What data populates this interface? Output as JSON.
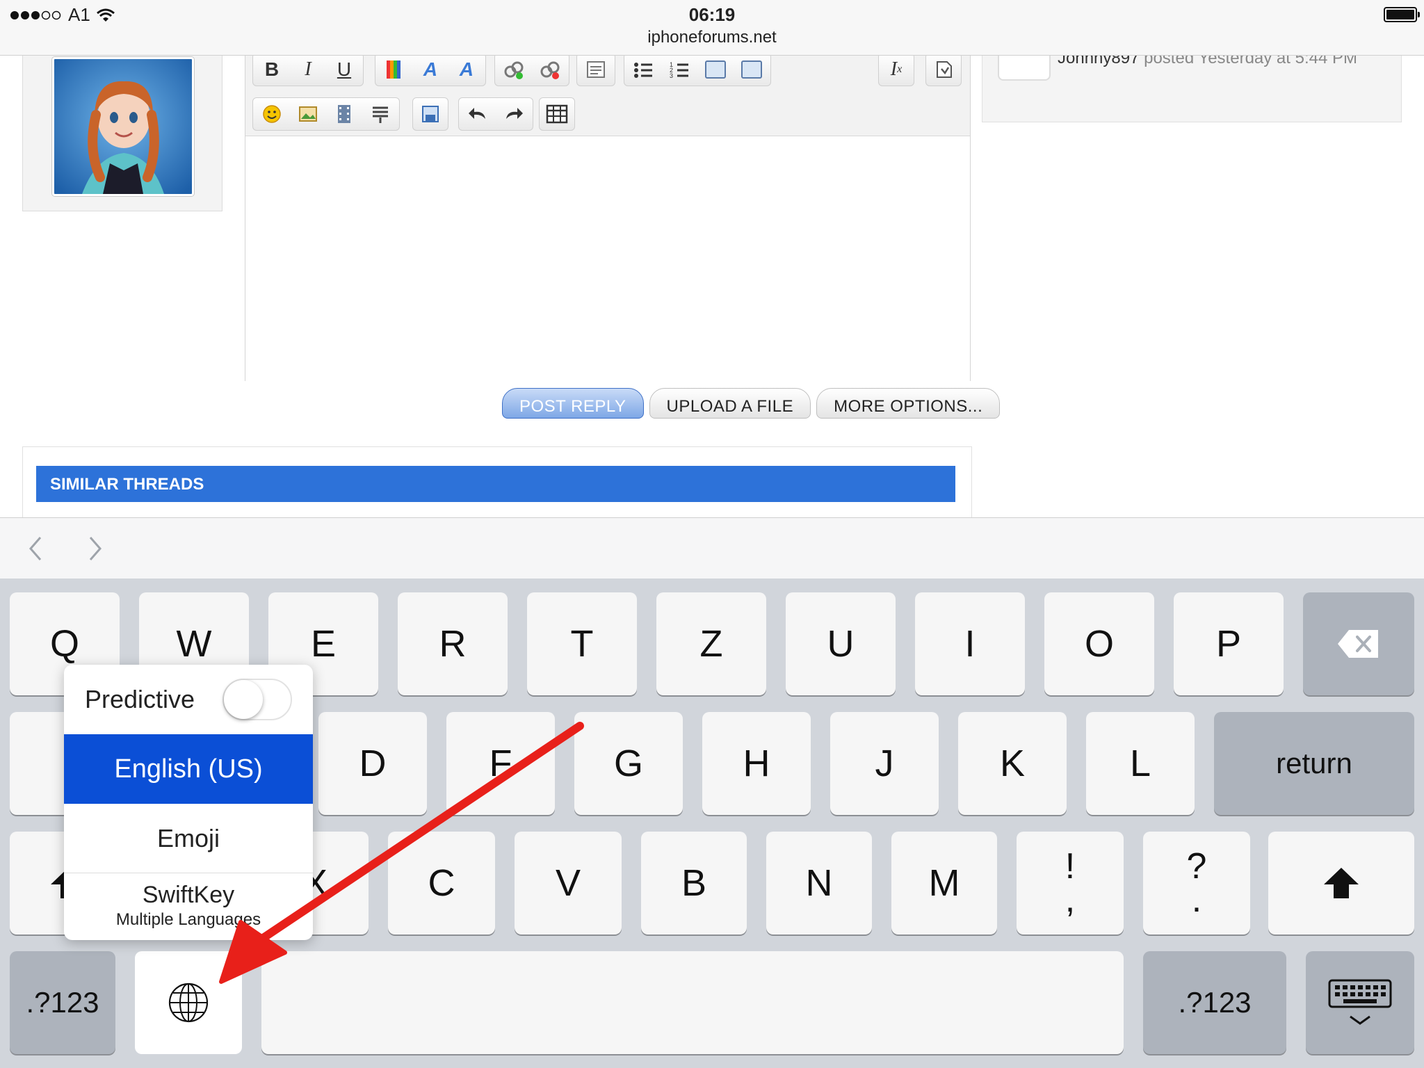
{
  "status_bar": {
    "carrier": "A1",
    "time": "06:19",
    "url": "iphoneforums.net"
  },
  "right_panel": {
    "author": "Johnny897",
    "posted_text": "posted Yesterday at 5:44 PM"
  },
  "toolbar": {
    "bold": "B",
    "italic": "I",
    "underline": "U"
  },
  "buttons": {
    "post_reply": "POST REPLY",
    "upload_file": "UPLOAD A FILE",
    "more_options": "MORE OPTIONS..."
  },
  "similar_threads": {
    "title": "SIMILAR THREADS"
  },
  "keyboard": {
    "row1": [
      "Q",
      "W",
      "E",
      "R",
      "T",
      "Z",
      "U",
      "I",
      "O",
      "P"
    ],
    "row2": [
      "D",
      "F",
      "G",
      "H",
      "J",
      "K",
      "L"
    ],
    "row3": [
      "X",
      "C",
      "V",
      "B",
      "N",
      "M"
    ],
    "return_label": "return",
    "punct1_top": "!",
    "punct1_bottom": ",",
    "punct2_top": "?",
    "punct2_bottom": ".",
    "numbers_label": ".?123"
  },
  "language_popup": {
    "predictive_label": "Predictive",
    "predictive_on": false,
    "english": "English (US)",
    "emoji": "Emoji",
    "swiftkey": "SwiftKey",
    "swiftkey_sub": "Multiple Languages"
  },
  "colors": {
    "annotation_arrow": "#e8201a",
    "selected_language": "#0b4fd6",
    "similar_threads_bar": "#2d72d9"
  }
}
